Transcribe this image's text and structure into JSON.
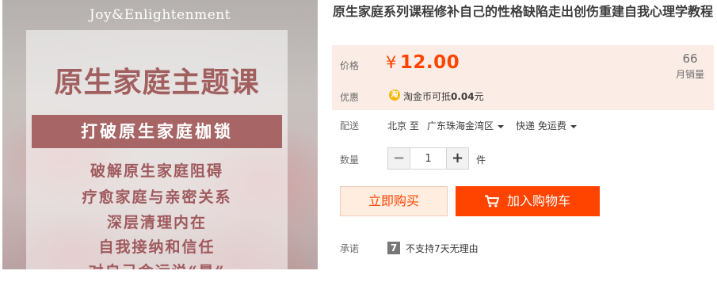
{
  "image": {
    "brand": "Joy&Enlightenment",
    "title": "原生家庭主题课",
    "band": "打破原生家庭枷锁",
    "lines": [
      "破解原生家庭阻碍",
      "疗愈家庭与亲密关系",
      "深层清理内在",
      "自我接纳和信任",
      "对自己命运说“是”"
    ]
  },
  "product": {
    "title": "原生家庭系列课程修补自己的性格缺陷走出创伤重建自我心理学教程"
  },
  "price": {
    "label": "价格",
    "currency": "¥",
    "value": "12.00",
    "sales_count": "66",
    "sales_label": "月销量"
  },
  "discount": {
    "label": "优惠",
    "icon": "taobao-coin-icon",
    "icon_glyph": "淘",
    "text_prefix": "淘金币可抵",
    "amount": "0.04",
    "text_suffix": "元"
  },
  "shipping": {
    "label": "配送",
    "from": "北京 至",
    "destination": "广东珠海金湾区",
    "method": "快递 免运费"
  },
  "quantity": {
    "label": "数量",
    "minus": "−",
    "value": "1",
    "plus": "+",
    "unit": "件"
  },
  "actions": {
    "buy_now": "立即购买",
    "add_to_cart": "加入购物车"
  },
  "promise": {
    "label": "承诺",
    "icon_glyph": "7",
    "text": "不支持7天无理由"
  },
  "colors": {
    "accent": "#ff4400",
    "price_bg": "#fbede6",
    "buy_now_bg": "#ffeee0",
    "image_title": "#a25f5f",
    "image_band": "#a76566"
  }
}
